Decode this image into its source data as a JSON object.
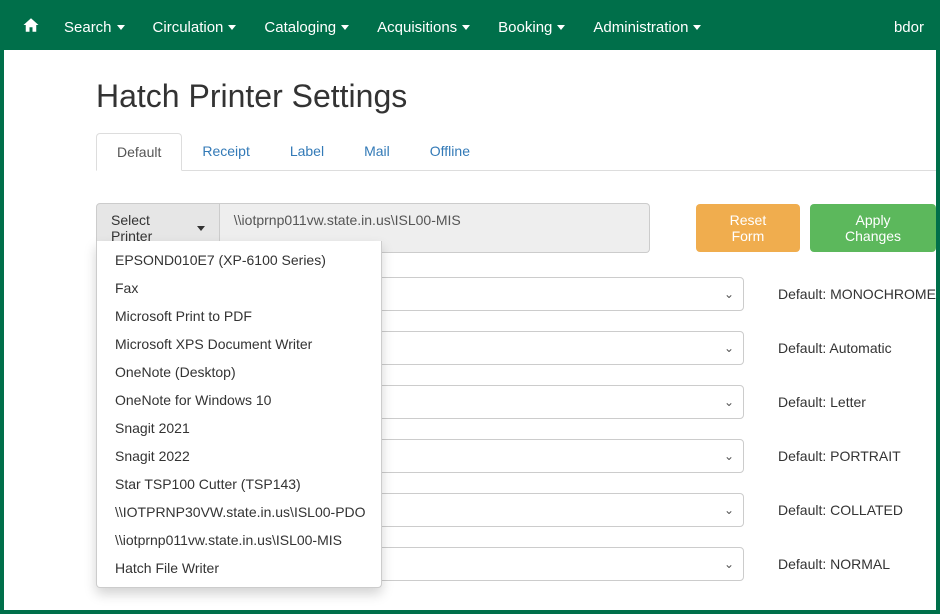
{
  "nav": {
    "items": [
      "Search",
      "Circulation",
      "Cataloging",
      "Acquisitions",
      "Booking",
      "Administration"
    ],
    "user": "bdor"
  },
  "page": {
    "title": "Hatch Printer Settings"
  },
  "tabs": [
    "Default",
    "Receipt",
    "Label",
    "Mail",
    "Offline"
  ],
  "active_tab": "Default",
  "printer": {
    "select_label": "Select Printer",
    "current": "\\\\iotprnp011vw.state.in.us\\ISL00-MIS",
    "options": [
      "EPSOND010E7 (XP-6100 Series)",
      "Fax",
      "Microsoft Print to PDF",
      "Microsoft XPS Document Writer",
      "OneNote (Desktop)",
      "OneNote for Windows 10",
      "Snagit 2021",
      "Snagit 2022",
      "Star TSP100 Cutter (TSP143)",
      "\\\\IOTPRNP30VW.state.in.us\\ISL00-PDO",
      "\\\\iotprnp011vw.state.in.us\\ISL00-MIS",
      "Hatch File Writer"
    ]
  },
  "buttons": {
    "reset": "Reset Form",
    "apply": "Apply Changes"
  },
  "settings": [
    {
      "default_label": "Default: MONOCHROME"
    },
    {
      "default_label": "Default: Automatic"
    },
    {
      "default_label": "Default: Letter"
    },
    {
      "default_label": "Default: PORTRAIT"
    },
    {
      "default_label": "Default: COLLATED"
    },
    {
      "default_label": "Default: NORMAL"
    }
  ]
}
